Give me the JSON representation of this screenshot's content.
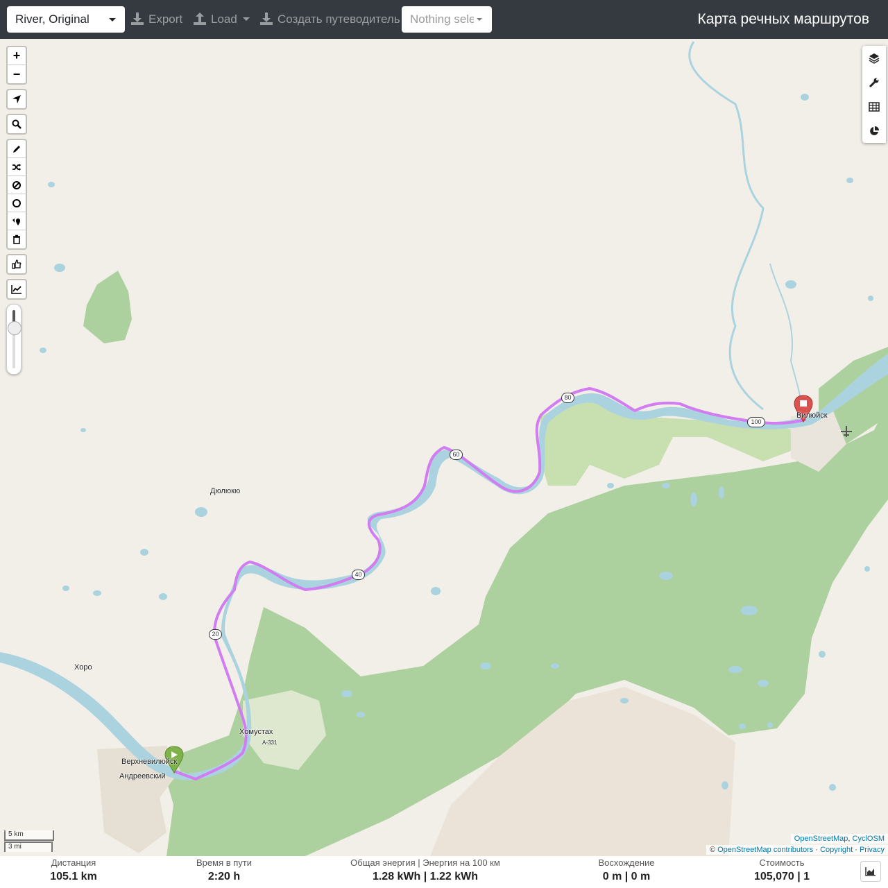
{
  "topbar": {
    "profile_select": "River, Original",
    "export_label": "Export",
    "load_label": "Load",
    "guide_label": "Создать путеводитель",
    "nothing_selected": "Nothing selected",
    "app_title": "Карта речных маршрутов"
  },
  "map": {
    "places": {
      "dyulyuyu": "Дюлюкю",
      "khoro": "Хоро",
      "verkhnevilyuysk": "Верхневилюйск",
      "andreevsky": "Андреевский",
      "khomustakh": "Хомустах",
      "vilyuysk": "Вилюйск",
      "road": "А-331"
    },
    "route_labels": {
      "km20": "20",
      "km40": "40",
      "km60": "60",
      "km80": "80",
      "km100": "100"
    },
    "scale": {
      "metric": "5 km",
      "imperial": "3 mi"
    },
    "attribution": {
      "layer1": "OpenStreetMap",
      "sep1": ", ",
      "layer2": "CyclOSM",
      "copy": "© ",
      "contributors": "OpenStreetMap contributors",
      "dot1": " · ",
      "copyright": "Copyright",
      "dot2": " · ",
      "privacy": "Privacy"
    },
    "zoom_in": "+",
    "zoom_out": "−",
    "colors": {
      "route": "#d17cf0",
      "water": "#aad3df",
      "forest": "#add19e",
      "land": "#f2efe9",
      "start_marker": "#7fb24a",
      "end_marker": "#d9534f"
    }
  },
  "stats": {
    "distance": {
      "label": "Дистанция",
      "value": "105.1 km"
    },
    "time": {
      "label": "Время в пути",
      "value": "2:20 h"
    },
    "energy": {
      "label": "Общая энергия | Энергия на 100 км",
      "value": "1.28 kWh | 1.22 kWh"
    },
    "ascent": {
      "label": "Восхождение",
      "value": "0 m | 0 m"
    },
    "cost": {
      "label": "Стоимость",
      "value": "105,070 | 1"
    }
  }
}
